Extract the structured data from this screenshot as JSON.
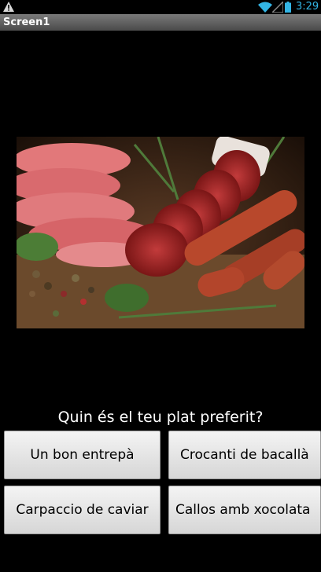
{
  "status_bar": {
    "time": "3:29",
    "icons": [
      "warning-icon",
      "wifi-icon",
      "signal-icon",
      "battery-icon"
    ],
    "accent_color": "#33b5e5"
  },
  "app": {
    "title": "Screen1"
  },
  "content": {
    "image": "cured-meats-photo",
    "question": "Quin és el teu plat preferit?",
    "options": [
      "Un bon entrepà",
      "Crocanti de bacallà",
      "Carpaccio de caviar",
      "Callos amb xocolata"
    ]
  }
}
